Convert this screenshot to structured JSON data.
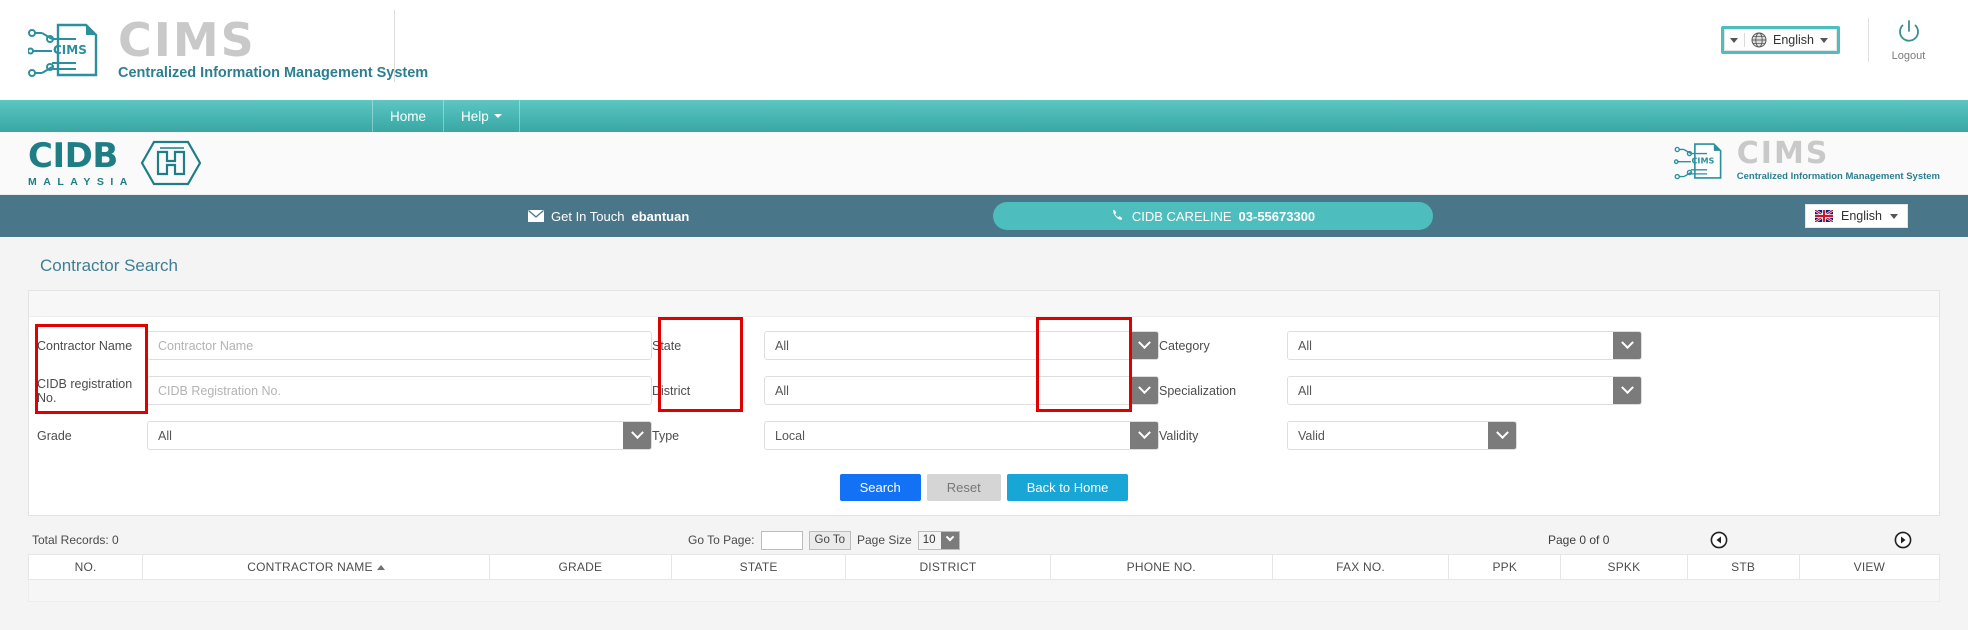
{
  "topbar": {
    "brand_word": "CIMS",
    "brand_sub": "Centralized Information Management System",
    "language_label": "English",
    "logout_label": "Logout"
  },
  "nav": {
    "items": [
      {
        "label": "Home",
        "has_caret": false
      },
      {
        "label": "Help",
        "has_caret": true
      }
    ]
  },
  "cidb": {
    "logo_main": "CIDB",
    "logo_sub": "MALAYSIA",
    "cims_word": "CIMS",
    "cims_sub": "Centralized Information Management System"
  },
  "contactbar": {
    "get_in_touch_text": "Get In Touch",
    "get_in_touch_value": "ebantuan",
    "careline_label": "CIDB CARELINE",
    "careline_number": "03-55673300",
    "language_label": "English"
  },
  "page": {
    "title": "Contractor Search"
  },
  "form": {
    "contractor_name": {
      "label": "Contractor Name",
      "placeholder": "Contractor Name",
      "value": ""
    },
    "cidb_registration_no": {
      "label": "CIDB registration No.",
      "placeholder": "CIDB Registration No.",
      "value": ""
    },
    "grade": {
      "label": "Grade",
      "value": "All",
      "options": [
        "All"
      ]
    },
    "state": {
      "label": "State",
      "value": "All",
      "options": [
        "All"
      ]
    },
    "district": {
      "label": "District",
      "value": "All",
      "options": [
        "All"
      ]
    },
    "type": {
      "label": "Type",
      "value": "Local",
      "options": [
        "Local"
      ]
    },
    "category": {
      "label": "Category",
      "value": "All",
      "options": [
        "All"
      ]
    },
    "specialization": {
      "label": "Specialization",
      "value": "All",
      "options": [
        "All"
      ]
    },
    "validity": {
      "label": "Validity",
      "value": "Valid",
      "options": [
        "Valid"
      ]
    }
  },
  "buttons": {
    "search": "Search",
    "reset": "Reset",
    "back_to_home": "Back to Home"
  },
  "results": {
    "total_records": "Total Records: 0",
    "go_to_page_label": "Go To Page:",
    "go_to_page_value": "",
    "go_to_button": "Go To",
    "page_size_label": "Page Size",
    "page_size_value": "10",
    "page_of": "Page 0 of 0",
    "columns": [
      "NO.",
      "CONTRACTOR NAME",
      "GRADE",
      "STATE",
      "DISTRICT",
      "PHONE NO.",
      "FAX NO.",
      "PPK",
      "SPKK",
      "STB",
      "VIEW"
    ],
    "sorted_column_index": 1,
    "rows": []
  },
  "colors": {
    "teal_nav": "#45b3b0",
    "slate_bar": "#4a7689",
    "accent_teal": "#4dbdbd",
    "cidb_green": "#1f7e85",
    "search_blue": "#1271f5",
    "home_blue": "#18a6d6",
    "annotation_red": "#e00000"
  }
}
